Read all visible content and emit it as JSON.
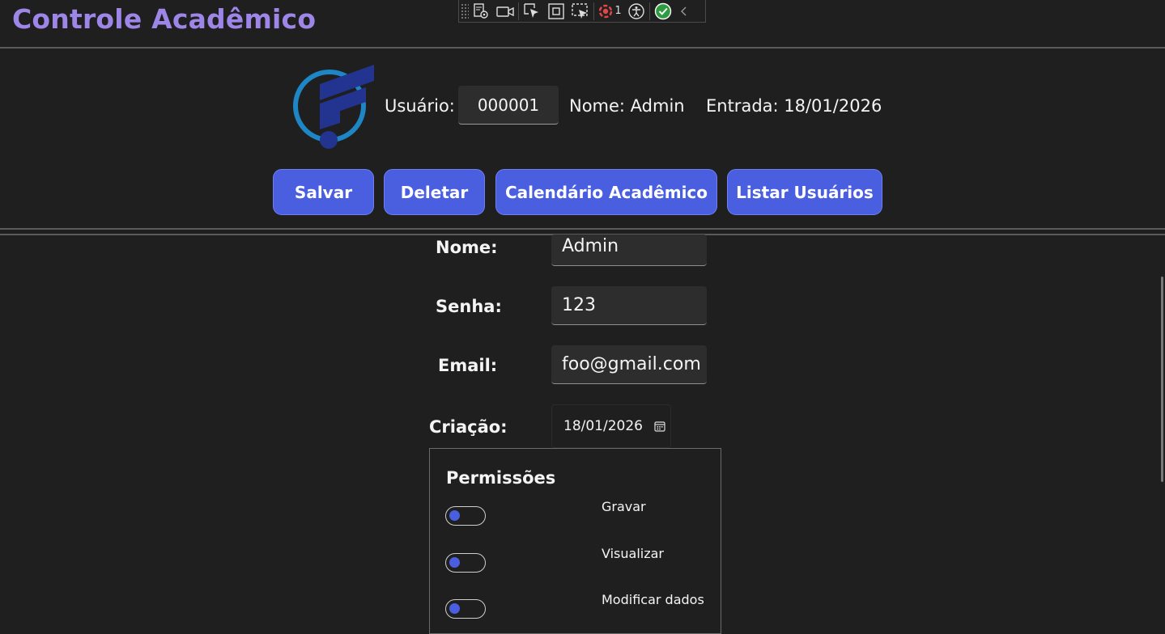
{
  "app": {
    "title": "Controle Acadêmico"
  },
  "debug_toolbar": {
    "icons": [
      "grip-icon",
      "visual-tree-icon",
      "video-icon",
      "select-element-icon",
      "display-layout-adorners-icon",
      "track-focus-icon",
      "binding-failures-icon",
      "accessibility-icon",
      "hot-reload-ok-icon",
      "collapse-chevron-icon"
    ],
    "binding_failures_count": "1"
  },
  "header": {
    "user_label": "Usuário:",
    "user_id": "000001",
    "name_text": "Nome: Admin",
    "entry_text": "Entrada: 18/01/2026"
  },
  "actions": {
    "save": "Salvar",
    "delete": "Deletar",
    "calendar": "Calendário Acadêmico",
    "list_users": "Listar Usuários"
  },
  "form": {
    "name_label": "Nome:",
    "name_value": "Admin",
    "password_label": "Senha:",
    "password_value": "123",
    "email_label": "Email:",
    "email_value": "foo@gmail.com",
    "creation_label": "Criação:",
    "creation_value": "18/01/2026"
  },
  "permissions": {
    "title": "Permissões",
    "items": [
      {
        "label": "Gravar",
        "enabled": false
      },
      {
        "label": "Visualizar",
        "enabled": false
      },
      {
        "label": "Modificar dados",
        "enabled": false
      }
    ]
  },
  "colors": {
    "accent": "#4a5fe0",
    "title": "#9d86e8",
    "background": "#1f1f1f"
  }
}
